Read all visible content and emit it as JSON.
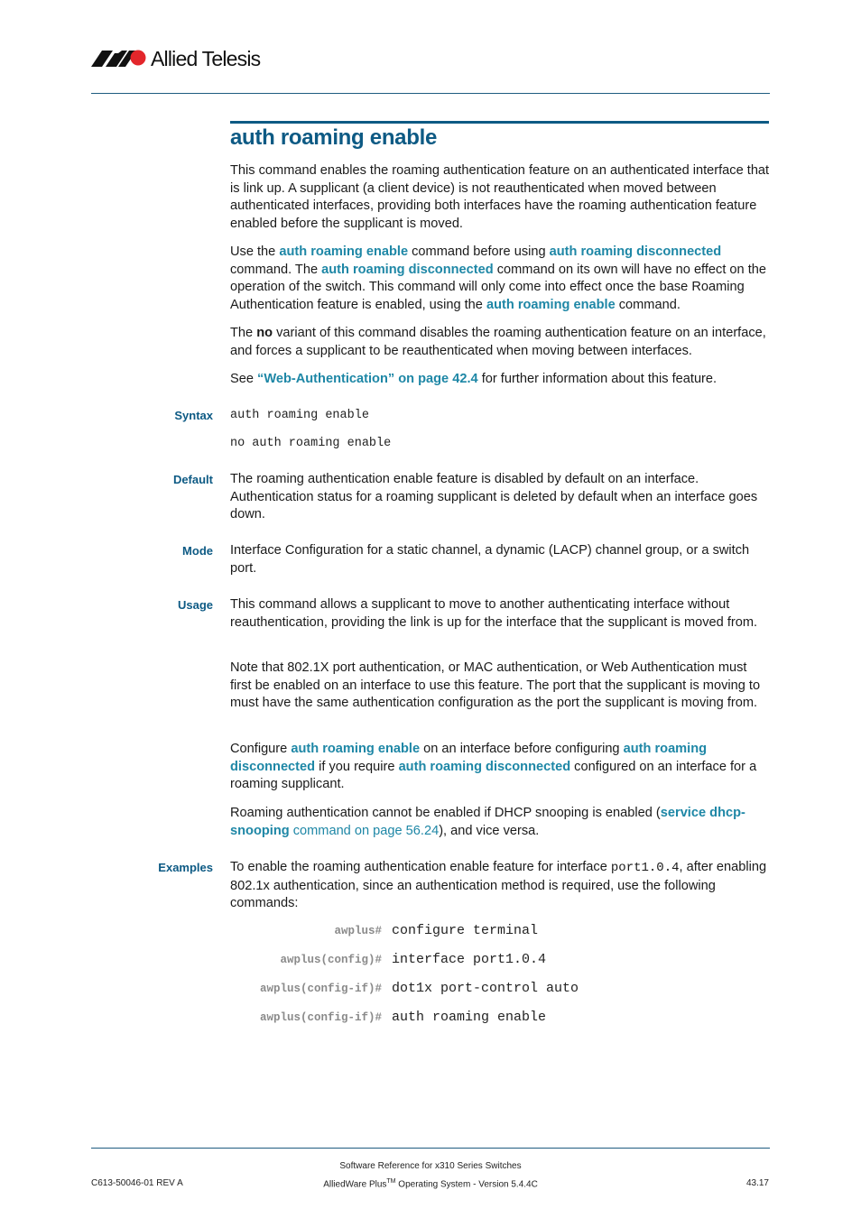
{
  "header": {
    "logo_text": "Allied Telesis",
    "logo_icon": "allied-telesis-logo-icon"
  },
  "title": "auth roaming enable",
  "intro": {
    "p1": "This command enables the roaming authentication feature on an authenticated interface that is link up. A supplicant (a client device) is not reauthenticated when moved between authenticated interfaces, providing both interfaces have the roaming authentication feature enabled before the supplicant is moved.",
    "p2": {
      "t1": "Use the ",
      "l1": "auth roaming enable",
      "t2": " command before using ",
      "l2": "auth roaming disconnected",
      "t3": " command. The ",
      "l3": "auth roaming disconnected",
      "t4": " command on its own will have no effect on the operation of the switch. This command will only come into effect once the base Roaming Authentication feature is enabled, using the ",
      "l4": "auth roaming enable",
      "t5": " command."
    },
    "p3": {
      "t1": "The ",
      "bold": "no",
      "t2": " variant of this command disables the roaming authentication feature on an interface, and forces a supplicant to be reauthenticated when moving between interfaces."
    },
    "p4": {
      "t1": "See ",
      "l1": "“Web-Authentication” on page 42.4",
      "t2": " for further information about this feature."
    }
  },
  "sections": {
    "syntax": {
      "label": "Syntax",
      "lines": [
        "auth roaming enable",
        "no auth roaming enable"
      ]
    },
    "default": {
      "label": "Default",
      "text": "The roaming authentication enable feature is disabled by default on an interface. Authentication status for a roaming supplicant is deleted by default when an interface goes down."
    },
    "mode": {
      "label": "Mode",
      "text": "Interface Configuration for a static channel, a dynamic (LACP) channel group, or a switch port."
    },
    "usage": {
      "label": "Usage",
      "p1": "This command allows a supplicant to move to another authenticating interface without reauthentication, providing the link is up for the interface that the supplicant is moved from.",
      "p2": "Note that 802.1X port authentication, or MAC authentication, or Web Authentication must first be enabled on an interface to use this feature. The port that the supplicant is moving to must have the same authentication configuration as the port the supplicant is moving from.",
      "p3": {
        "t1": "Configure ",
        "l1": "auth roaming enable",
        "t2": " on an interface before configuring ",
        "l2": "auth roaming disconnected",
        "t3": " if you require ",
        "l3": "auth roaming disconnected",
        "t4": " configured on an interface for a roaming supplicant."
      },
      "p4": {
        "t1": "Roaming authentication cannot be enabled if DHCP snooping is enabled (",
        "l1": "service dhcp-snooping",
        "l2": " command on page 56.24",
        "t2": "), and vice versa."
      }
    },
    "examples": {
      "label": "Examples",
      "t1": "To enable the roaming authentication enable feature for interface ",
      "code": "port1.0.4",
      "t2": ", after enabling 802.1x authentication, since an authentication method is required, use the following commands:",
      "commands": [
        {
          "prompt": "awplus#",
          "cmd": "configure terminal"
        },
        {
          "prompt": "awplus(config)#",
          "cmd": "interface port1.0.4"
        },
        {
          "prompt": "awplus(config-if)#",
          "cmd": "dot1x port-control auto"
        },
        {
          "prompt": "awplus(config-if)#",
          "cmd": "auth roaming enable"
        }
      ]
    }
  },
  "footer": {
    "doc_id": "C613-50046-01 REV A",
    "line1": "Software Reference for x310 Series Switches",
    "line2a": "AlliedWare Plus",
    "line2_sup": "TM",
    "line2b": " Operating System - Version 5.4.4C",
    "page": "43.17"
  },
  "colors": {
    "heading": "#0d5a84",
    "link": "#1e87a6",
    "prompt": "#8a8a8a",
    "logo_red": "#e3262b"
  }
}
